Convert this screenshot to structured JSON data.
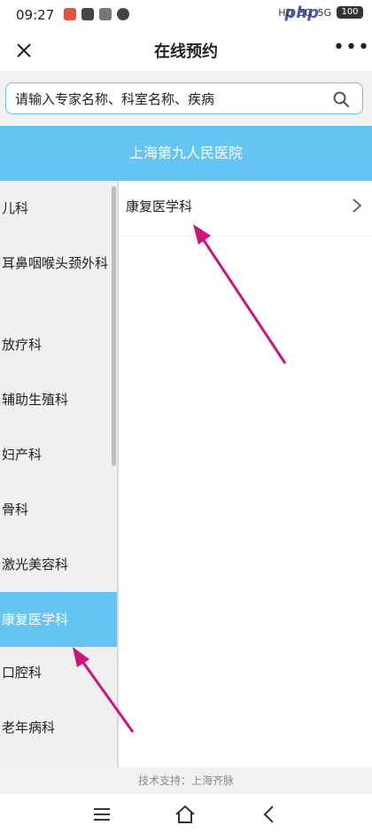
{
  "status_bar": {
    "time": "09:27",
    "network_labels": [
      "HD",
      "3G",
      "5G"
    ],
    "battery": "100",
    "watermark": "php"
  },
  "header": {
    "title": "在线预约",
    "more_label": "•••"
  },
  "search": {
    "placeholder": "请输入专家名称、科室名称、疾病"
  },
  "hospital": {
    "name": "上海第九人民医院"
  },
  "departments": [
    "儿科",
    "耳鼻咽喉头颈外科",
    "放疗科",
    "辅助生殖科",
    "妇产科",
    "骨科",
    "激光美容科",
    "康复医学科",
    "口腔科",
    "老年病科"
  ],
  "selected_department": "康复医学科",
  "sub_departments": [
    "康复医学科"
  ],
  "footer": {
    "support_text": "技术支持：上海齐脉"
  },
  "colors": {
    "accent": "#64c4f2",
    "annotation_arrow": "#d0137a"
  }
}
